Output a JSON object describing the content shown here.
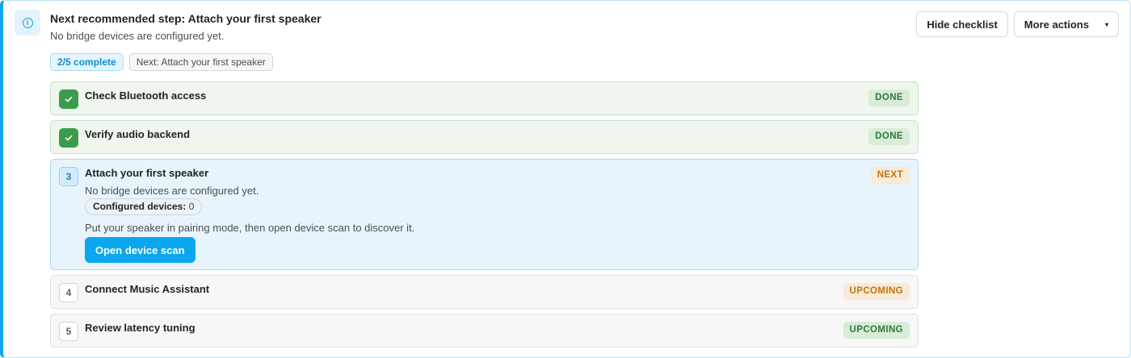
{
  "header": {
    "title": "Next recommended step: Attach your first speaker",
    "subtitle": "No bridge devices are configured yet.",
    "icon": "info-icon",
    "progress_chip": "2/5 complete",
    "next_chip": "Next: Attach your first speaker"
  },
  "actions": {
    "hide_checklist": "Hide checklist",
    "more_actions": "More actions",
    "more_actions_caret": "▾"
  },
  "steps": [
    {
      "title": "Check Bluetooth access",
      "status": "DONE",
      "state": "done"
    },
    {
      "title": "Verify audio backend",
      "status": "DONE",
      "state": "done"
    },
    {
      "number": "3",
      "title": "Attach your first speaker",
      "status": "NEXT",
      "state": "current",
      "description": "No bridge devices are configured yet.",
      "count_label": "Configured devices:",
      "count_value": "0",
      "hint": "Put your speaker in pairing mode, then open device scan to discover it.",
      "action_label": "Open device scan"
    },
    {
      "number": "4",
      "title": "Connect Music Assistant",
      "status": "UPCOMING",
      "state": "upcoming"
    },
    {
      "number": "5",
      "title": "Review latency tuning",
      "status": "UPCOMING",
      "state": "upcoming"
    }
  ],
  "colors": {
    "accent": "#10a5ec",
    "done_green": "#3c9c4c",
    "next_orange": "#c17609"
  }
}
